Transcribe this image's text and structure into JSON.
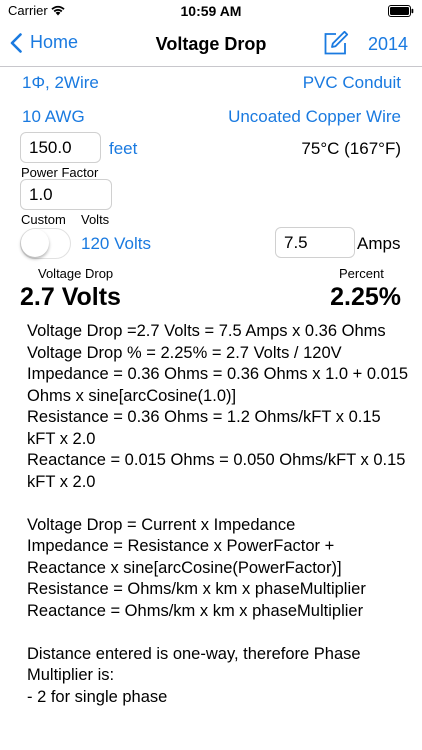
{
  "status": {
    "carrier": "Carrier",
    "time": "10:59 AM"
  },
  "nav": {
    "back_label": "Home",
    "title": "Voltage Drop",
    "year": "2014"
  },
  "settings": {
    "phase": "1Φ, 2Wire",
    "conduit": "PVC Conduit",
    "wire_size": "10 AWG",
    "wire_type": "Uncoated Copper Wire",
    "temperature": "75°C (167°F)"
  },
  "inputs": {
    "distance_value": "150.0",
    "distance_unit": "feet",
    "power_factor_label": "Power Factor",
    "power_factor_value": "1.0",
    "custom_label": "Custom",
    "volts_label": "Volts",
    "custom_enabled": false,
    "voltage": "120 Volts",
    "amps_value": "7.5",
    "amps_unit": "Amps"
  },
  "results": {
    "voltage_drop_label": "Voltage Drop",
    "voltage_drop_value": "2.7 Volts",
    "percent_label": "Percent",
    "percent_value": "2.25%"
  },
  "details": [
    "Voltage Drop =2.7 Volts = 7.5 Amps x 0.36 Ohms",
    "Voltage Drop % = 2.25% = 2.7 Volts / 120V",
    "Impedance = 0.36 Ohms = 0.36 Ohms x 1.0 + 0.015 Ohms x sine[arcCosine(1.0)]",
    "Resistance = 0.36 Ohms = 1.2 Ohms/kFT x 0.15 kFT x 2.0",
    "Reactance = 0.015 Ohms = 0.050 Ohms/kFT x 0.15 kFT x 2.0",
    "",
    "Voltage Drop = Current x Impedance",
    "Impedance = Resistance x PowerFactor + Reactance x sine[arcCosine(PowerFactor)]",
    "Resistance = Ohms/km x km x phaseMultiplier",
    "Reactance = Ohms/km x km x phaseMultiplier",
    "",
    "Distance entered is one-way, therefore Phase Multiplier is:",
    "- 2 for single phase"
  ],
  "colors": {
    "accent": "#1a7ae0"
  }
}
